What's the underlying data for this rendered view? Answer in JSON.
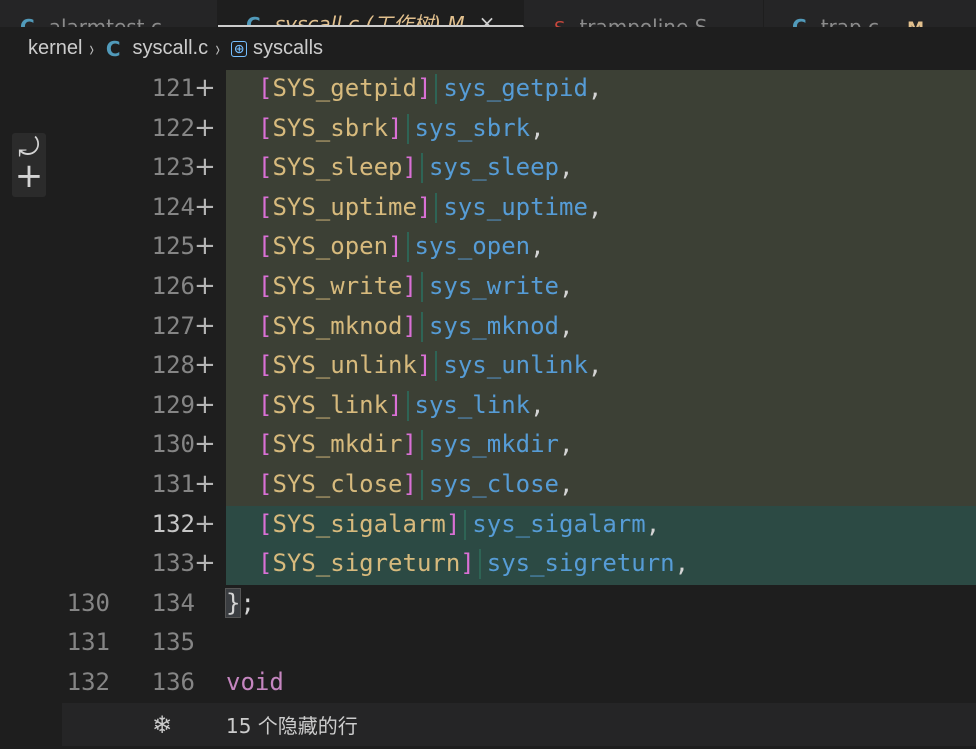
{
  "tabs": [
    {
      "icon": "C",
      "label": "alarmtest.c",
      "active": false
    },
    {
      "icon": "C",
      "label": "syscall.c (工作树) M",
      "active": true,
      "close": "×"
    },
    {
      "icon": "S",
      "label": "trampoline.S",
      "active": false
    },
    {
      "icon": "C",
      "label": "trap.c",
      "badge": "M",
      "active": false
    }
  ],
  "breadcrumb": {
    "folder": "kernel",
    "file_icon": "C",
    "file": "syscall.c",
    "symbol_icon": "[⊕]",
    "symbol": "syscalls",
    "separator": "›"
  },
  "revert_widget": {
    "top_icon": "⤾",
    "bottom_icon": "+"
  },
  "lines": [
    {
      "old": "",
      "new": "121",
      "mark": "+",
      "key": "SYS_getpid",
      "fn": "sys_getpid"
    },
    {
      "old": "",
      "new": "122",
      "mark": "+",
      "key": "SYS_sbrk",
      "fn": "sys_sbrk"
    },
    {
      "old": "",
      "new": "123",
      "mark": "+",
      "key": "SYS_sleep",
      "fn": "sys_sleep"
    },
    {
      "old": "",
      "new": "124",
      "mark": "+",
      "key": "SYS_uptime",
      "fn": "sys_uptime"
    },
    {
      "old": "",
      "new": "125",
      "mark": "+",
      "key": "SYS_open",
      "fn": "sys_open"
    },
    {
      "old": "",
      "new": "126",
      "mark": "+",
      "key": "SYS_write",
      "fn": "sys_write"
    },
    {
      "old": "",
      "new": "127",
      "mark": "+",
      "key": "SYS_mknod",
      "fn": "sys_mknod"
    },
    {
      "old": "",
      "new": "128",
      "mark": "+",
      "key": "SYS_unlink",
      "fn": "sys_unlink"
    },
    {
      "old": "",
      "new": "129",
      "mark": "+",
      "key": "SYS_link",
      "fn": "sys_link"
    },
    {
      "old": "",
      "new": "130",
      "mark": "+",
      "key": "SYS_mkdir",
      "fn": "sys_mkdir"
    },
    {
      "old": "",
      "new": "131",
      "mark": "+",
      "key": "SYS_close",
      "fn": "sys_close"
    },
    {
      "old": "",
      "new": "132",
      "mark": "+",
      "key": "SYS_sigalarm",
      "fn": "sys_sigalarm"
    },
    {
      "old": "",
      "new": "133",
      "mark": "+",
      "key": "SYS_sigreturn",
      "fn": "sys_sigreturn"
    },
    {
      "old": "130",
      "new": "134",
      "mark": "",
      "text": "};"
    },
    {
      "old": "131",
      "new": "135",
      "mark": "",
      "text": ""
    },
    {
      "old": "132",
      "new": "136",
      "mark": "",
      "text": "void"
    }
  ],
  "hidden_lines": {
    "icon": "❄",
    "text": "15 个隐藏的行"
  },
  "colors": {
    "added_dim": "#3c4035",
    "added_bright": "#2c4a44",
    "bracket": "#da70d6",
    "key": "#d7ba7d",
    "function": "#569cd6",
    "keyword": "#c586c0"
  }
}
